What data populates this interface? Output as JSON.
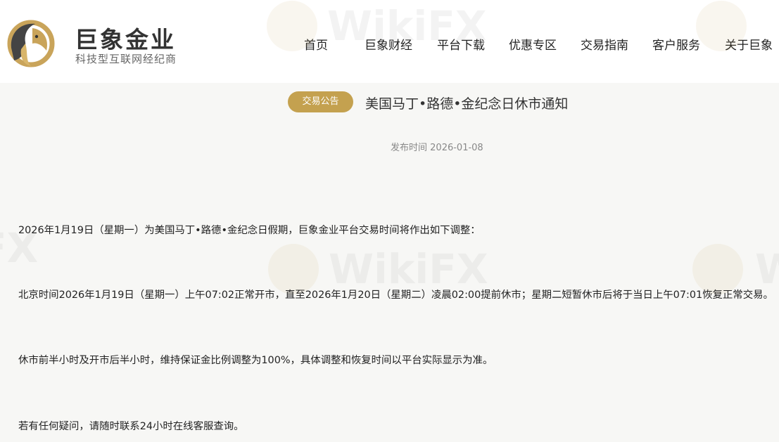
{
  "brand": {
    "name": "巨象金业",
    "slogan": "科技型互联网经纪商",
    "logo_icon": "elephant-logo-icon"
  },
  "nav": [
    {
      "label": "首页"
    },
    {
      "label": "巨象财经"
    },
    {
      "label": "平台下载"
    },
    {
      "label": "优惠专区"
    },
    {
      "label": "交易指南"
    },
    {
      "label": "客户服务"
    },
    {
      "label": "关于巨象"
    }
  ],
  "article": {
    "badge": "交易公告",
    "title": "美国马丁•路德•金纪念日休市通知",
    "publish_label": "发布时间",
    "publish_date": "2026-01-08",
    "paragraphs": [
      "2026年1月19日（星期一）为美国马丁•路德•金纪念日假期，巨象金业平台交易时间将作出如下调整：",
      "北京时间2026年1月19日（星期一）上午07:02正常开市，直至2026年1月20日（星期二）凌晨02:00提前休市；星期二短暂休市后将于当日上午07:01恢复正常交易。",
      "休市前半小时及开市后半小时，维持保证金比例调整为100%，具体调整和恢复时间以平台实际显示为准。",
      "若有任何疑问，请随时联系24小时在线客服查询。"
    ]
  },
  "watermark": {
    "text": "WikiFX"
  },
  "colors": {
    "accent": "#c4a14f",
    "header_bg": "#ffffff",
    "body_bg": "#f7f7f5",
    "text": "#222222",
    "muted": "#888888"
  }
}
